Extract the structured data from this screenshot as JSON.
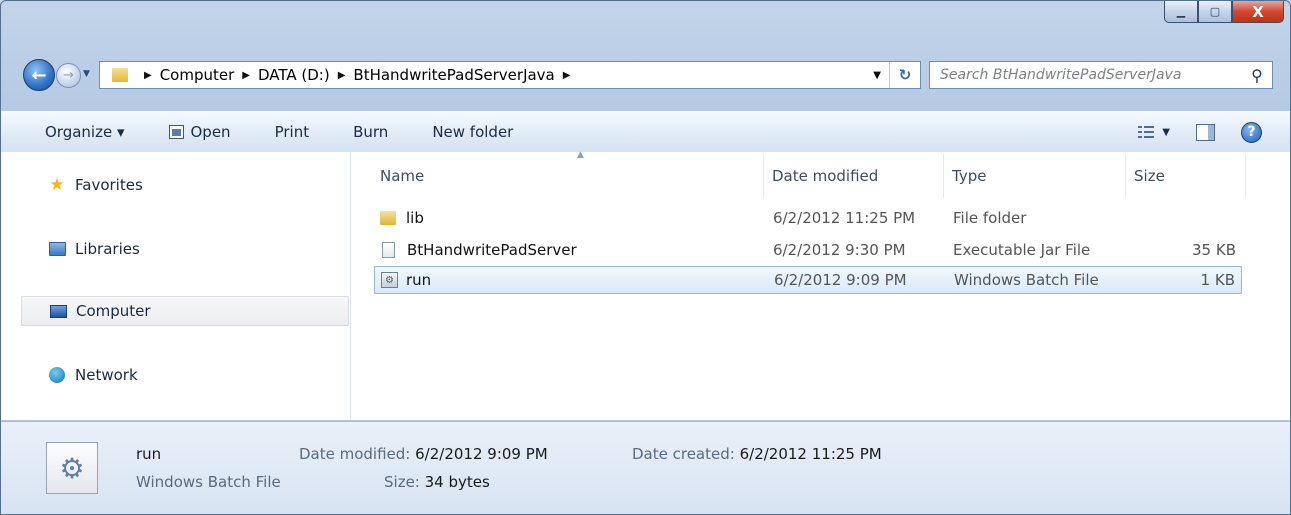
{
  "address": {
    "crumbs": [
      "Computer",
      "DATA (D:)",
      "BtHandwritePadServerJava"
    ]
  },
  "search": {
    "placeholder": "Search BtHandwritePadServerJava"
  },
  "toolbar": {
    "organize": "Organize ▾",
    "open": "Open",
    "print": "Print",
    "burn": "Burn",
    "new_folder": "New folder"
  },
  "nav": {
    "favorites": "Favorites",
    "libraries": "Libraries",
    "computer": "Computer",
    "network": "Network"
  },
  "columns": {
    "name": "Name",
    "date": "Date modified",
    "type": "Type",
    "size": "Size"
  },
  "files": [
    {
      "name": "lib",
      "date": "6/2/2012 11:25 PM",
      "type": "File folder",
      "size": ""
    },
    {
      "name": "BtHandwritePadServer",
      "date": "6/2/2012 9:30 PM",
      "type": "Executable Jar File",
      "size": "35 KB"
    },
    {
      "name": "run",
      "date": "6/2/2012 9:09 PM",
      "type": "Windows Batch File",
      "size": "1 KB"
    }
  ],
  "details": {
    "name": "run",
    "type": "Windows Batch File",
    "date_modified_label": "Date modified:",
    "date_modified": "6/2/2012 9:09 PM",
    "size_label": "Size:",
    "size": "34 bytes",
    "date_created_label": "Date created:",
    "date_created": "6/2/2012 11:25 PM"
  }
}
